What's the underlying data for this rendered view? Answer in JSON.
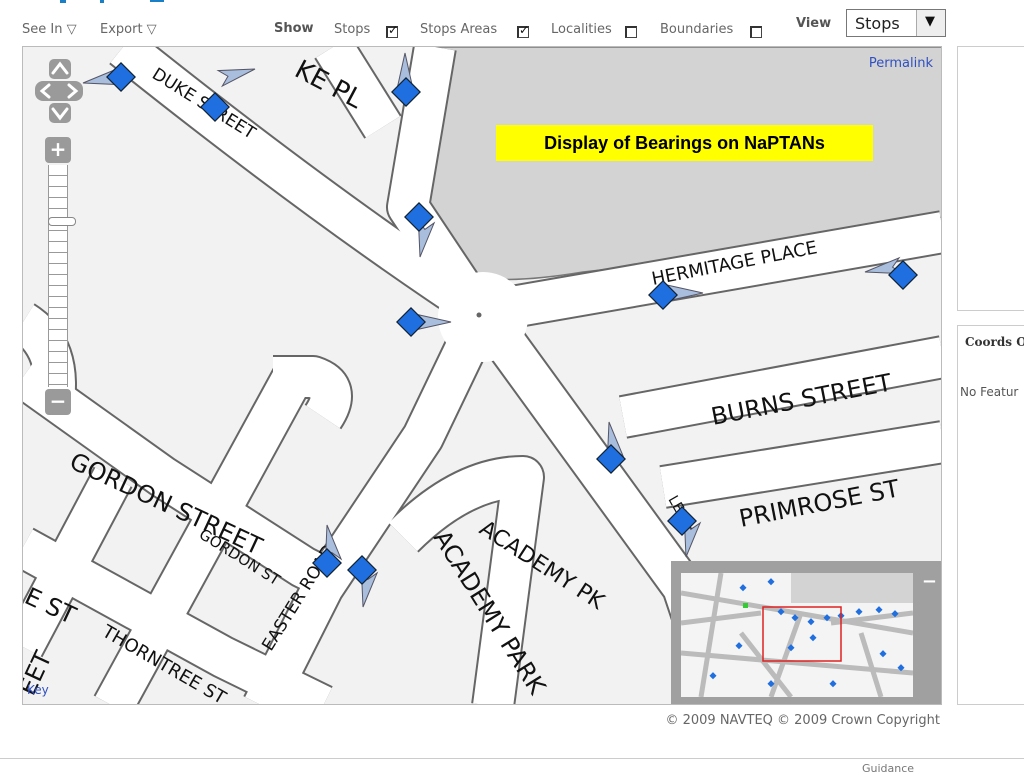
{
  "toolbar": {
    "see_in": "See In ▽",
    "export": "Export ▽",
    "show_label": "Show",
    "layers": [
      {
        "label": "Stops",
        "checked": true
      },
      {
        "label": "Stops Areas",
        "checked": true
      },
      {
        "label": "Localities",
        "checked": false
      },
      {
        "label": "Boundaries",
        "checked": false
      }
    ],
    "view_label": "View",
    "view_value": "Stops",
    "brand_color": "#1a7fc4"
  },
  "map": {
    "permalink": "Permalink",
    "title_label": "Display of Bearings on NaPTANs",
    "key": "Key",
    "street_names": {
      "duke_pl": "KE PL",
      "duke_street": "DUKE STREET",
      "hermitage_place": "HERMITAGE PLACE",
      "burns_street": "BURNS STREET",
      "primrose_st": "PRIMROSE ST",
      "gordon_street": "GORDON STREET",
      "gordon_st": "GORDON ST",
      "easter_road": "EASTER ROAD",
      "academy_pk": "ACADEMY PK",
      "academy_park": "ACADEMY PARK",
      "thorntree_st": "THORNTREE ST",
      "left_st": "E ST",
      "left_eet": "EET",
      "leith_fragment": "LEITH"
    },
    "colors": {
      "road": "#ffffff",
      "road_edge": "#555555",
      "land": "#f2f2f2",
      "park": "#d3d3d3",
      "stop": "#1f6fe0",
      "bearing": "#a8bedc"
    },
    "copyright": "© 2009 NAVTEQ © 2009 Crown Copyright"
  },
  "overview": {
    "minus": "−"
  },
  "panels": {
    "coords_title": "Coords O",
    "no_features": "No Featur"
  },
  "footer": {
    "text": "Guidance"
  }
}
